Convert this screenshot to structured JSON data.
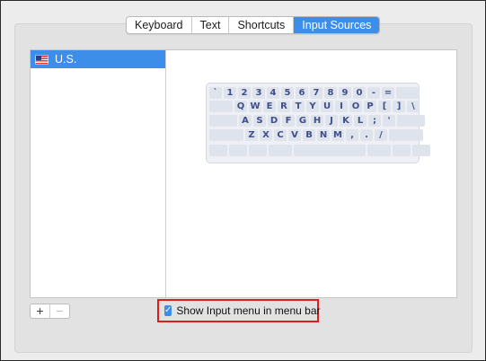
{
  "tabs": [
    "Keyboard",
    "Text",
    "Shortcuts",
    "Input Sources"
  ],
  "active_tab": "Input Sources",
  "sources": [
    {
      "label": "U.S.",
      "flag": "us-flag-icon"
    }
  ],
  "keyboard": {
    "row1": [
      "`",
      "1",
      "2",
      "3",
      "4",
      "5",
      "6",
      "7",
      "8",
      "9",
      "0",
      "-",
      "="
    ],
    "row2": [
      "Q",
      "W",
      "E",
      "R",
      "T",
      "Y",
      "U",
      "I",
      "O",
      "P",
      "[",
      "]",
      "\\"
    ],
    "row3": [
      "A",
      "S",
      "D",
      "F",
      "G",
      "H",
      "J",
      "K",
      "L",
      ";",
      "'"
    ],
    "row4": [
      "Z",
      "X",
      "C",
      "V",
      "B",
      "N",
      "M",
      ",",
      ".",
      "/"
    ]
  },
  "buttons": {
    "add": "+",
    "remove": "−"
  },
  "show_input_menu": {
    "label": "Show Input menu in menu bar",
    "checked": true,
    "check_glyph": "✓"
  },
  "colors": {
    "accent": "#3d8ee8",
    "highlight_box": "#e01c1c",
    "key_text": "#3d4f8c"
  }
}
